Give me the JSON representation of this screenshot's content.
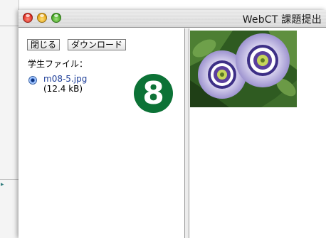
{
  "window": {
    "title": "WebCT 課題提出"
  },
  "toolbar": {
    "close_label": "閉じる",
    "download_label": "ダウンロード"
  },
  "files": {
    "label": "学生ファイル：",
    "items": [
      {
        "name": "m08-5.jpg",
        "size": "(12.4 kB)",
        "selected": true
      }
    ]
  },
  "step_badge": "8",
  "colors": {
    "badge": "#0c7236",
    "link": "#1f3f99"
  }
}
